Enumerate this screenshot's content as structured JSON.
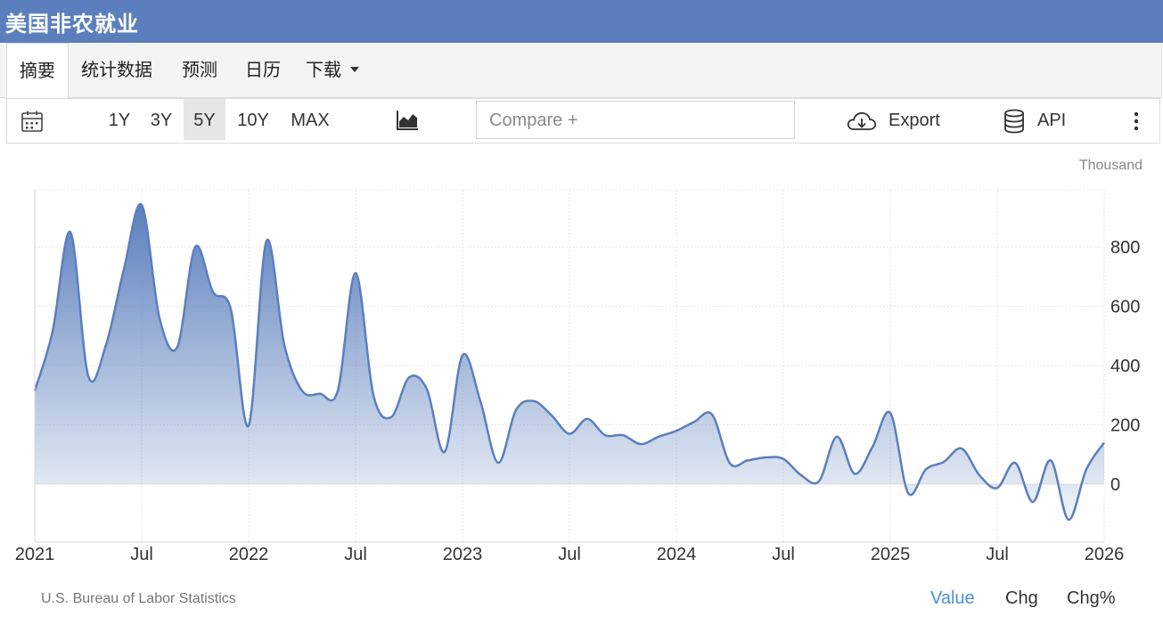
{
  "header": {
    "title": "美国非农就业"
  },
  "tabs": [
    {
      "label": "摘要",
      "active": true
    },
    {
      "label": "统计数据",
      "active": false
    },
    {
      "label": "预测",
      "active": false
    },
    {
      "label": "日历",
      "active": false
    },
    {
      "label": "下载",
      "active": false
    }
  ],
  "toolbar": {
    "calendar_icon": "calendar-icon",
    "ranges": [
      {
        "label": "1Y",
        "active": false
      },
      {
        "label": "3Y",
        "active": false
      },
      {
        "label": "5Y",
        "active": true
      },
      {
        "label": "10Y",
        "active": false
      },
      {
        "label": "MAX",
        "active": false
      }
    ],
    "chart_type_icon": "area-chart-icon",
    "compare_placeholder": "Compare +",
    "export_icon": "cloud-download-icon",
    "export_label": "Export",
    "api_icon": "database-icon",
    "api_label": "API",
    "more_icon": "more-vertical-icon"
  },
  "colors": {
    "header": "#5b7fbd",
    "line": "#5b7fbd",
    "active_view": "#4a8fd3"
  },
  "footer": {
    "source": "U.S. Bureau of Labor Statistics",
    "views": [
      {
        "label": "Value",
        "active": true
      },
      {
        "label": "Chg",
        "active": false
      },
      {
        "label": "Chg%",
        "active": false
      }
    ]
  },
  "chart_data": {
    "type": "area",
    "unit": "Thousand",
    "ylim": [
      -150,
      1000
    ],
    "yticks": [
      0,
      200,
      400,
      600,
      800
    ],
    "xlim": [
      "2021-01",
      "2026-01"
    ],
    "xticks": [
      "2021",
      "Jul",
      "2022",
      "Jul",
      "2023",
      "Jul",
      "2024",
      "Jul",
      "2025",
      "Jul",
      "2026"
    ],
    "grid": true,
    "x": [
      "2021-01",
      "2021-02",
      "2021-03",
      "2021-04",
      "2021-05",
      "2021-06",
      "2021-07",
      "2021-08",
      "2021-09",
      "2021-10",
      "2021-11",
      "2021-12",
      "2022-01",
      "2022-02",
      "2022-03",
      "2022-04",
      "2022-05",
      "2022-06",
      "2022-07",
      "2022-08",
      "2022-09",
      "2022-10",
      "2022-11",
      "2022-12",
      "2023-01",
      "2023-02",
      "2023-03",
      "2023-04",
      "2023-05",
      "2023-06",
      "2023-07",
      "2023-08",
      "2023-09",
      "2023-10",
      "2023-11",
      "2023-12",
      "2024-01",
      "2024-02",
      "2024-03",
      "2024-04",
      "2024-05",
      "2024-06",
      "2024-07",
      "2024-08",
      "2024-09",
      "2024-10",
      "2024-11",
      "2024-12",
      "2025-01",
      "2025-02",
      "2025-03",
      "2025-04",
      "2025-05",
      "2025-06",
      "2025-07",
      "2025-08",
      "2025-09",
      "2025-10",
      "2025-11",
      "2025-12",
      "2026-01"
    ],
    "values": [
      315,
      515,
      850,
      365,
      470,
      725,
      942,
      560,
      463,
      800,
      648,
      590,
      198,
      820,
      470,
      315,
      305,
      315,
      712,
      300,
      226,
      360,
      320,
      109,
      435,
      280,
      72,
      250,
      280,
      232,
      170,
      220,
      165,
      165,
      135,
      160,
      180,
      210,
      235,
      70,
      80,
      90,
      85,
      30,
      10,
      160,
      35,
      125,
      240,
      -30,
      50,
      75,
      120,
      30,
      -13,
      72,
      -60,
      80,
      -120,
      50,
      140
    ]
  }
}
